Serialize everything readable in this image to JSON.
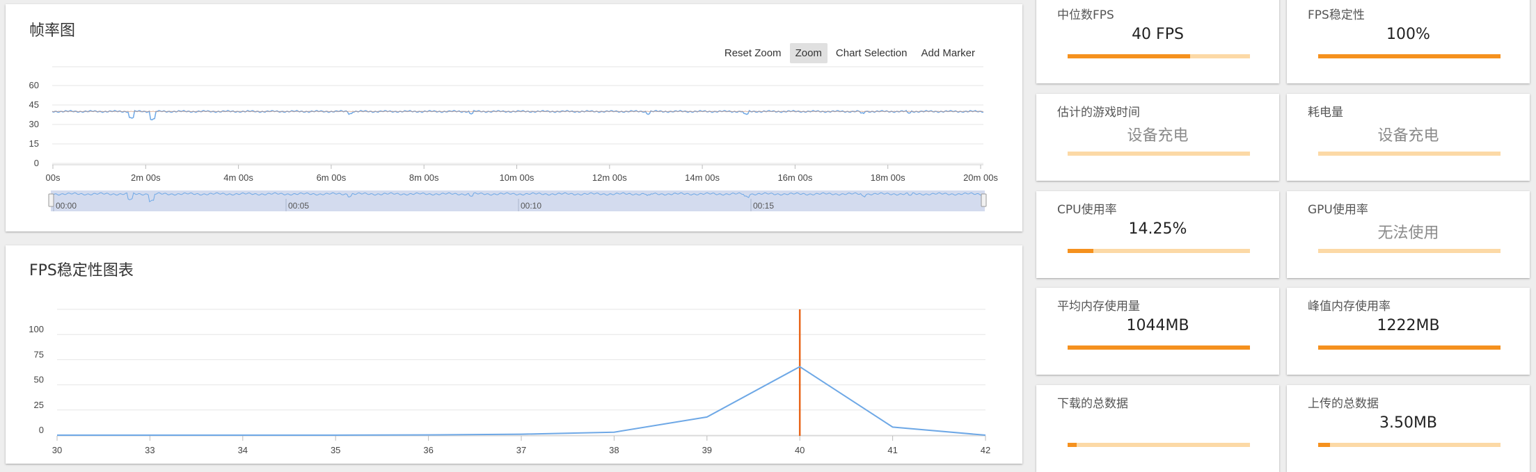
{
  "colors": {
    "accent": "#f5911e",
    "accent_light": "#fcd9a6",
    "line_blue": "#6ea8e6",
    "marker_orange": "#e8661a",
    "navigator_fill": "#d3dbee"
  },
  "frame_chart": {
    "title": "帧率图",
    "toolbar": [
      "Reset Zoom",
      "Zoom",
      "Chart Selection",
      "Add Marker"
    ],
    "active_tool": "Zoom",
    "y_ticks": [
      "60",
      "45",
      "30",
      "15",
      "0"
    ],
    "x_ticks": [
      "00s",
      "2m 00s",
      "4m 00s",
      "6m 00s",
      "8m 00s",
      "10m 00s",
      "12m 00s",
      "14m 00s",
      "16m 00s",
      "18m 00s",
      "20m 00s"
    ],
    "navigator_ticks": [
      "00:00",
      "00:05",
      "00:10",
      "00:15"
    ]
  },
  "stability_chart": {
    "title": "FPS稳定性图表",
    "y_ticks": [
      "100",
      "75",
      "50",
      "25",
      "0"
    ],
    "x_ticks": [
      "30",
      "33",
      "34",
      "35",
      "36",
      "37",
      "38",
      "39",
      "40",
      "41",
      "42"
    ]
  },
  "chart_data": [
    {
      "type": "line",
      "title": "帧率图",
      "xlabel": "",
      "ylabel": "",
      "ylim": [
        0,
        60
      ],
      "x_range_seconds": [
        0,
        1210
      ],
      "series": [
        {
          "values_approx": "flat around 40 FPS with occasional dips to ~36 and ~33",
          "mean": 40
        }
      ],
      "grid": true
    },
    {
      "type": "line",
      "title": "FPS稳定性图表",
      "xlabel": "",
      "ylabel": "",
      "ylim": [
        0,
        125
      ],
      "categories": [
        "30",
        "33",
        "34",
        "35",
        "36",
        "37",
        "38",
        "39",
        "40",
        "41",
        "42"
      ],
      "series": [
        {
          "values": [
            0,
            0,
            0,
            0,
            0.3,
            1,
            3,
            18,
            68,
            8,
            0
          ]
        }
      ],
      "marker_at": "40",
      "grid": true
    }
  ],
  "stats": [
    {
      "label": "中位数FPS",
      "value": "40 FPS",
      "progress": 0.67,
      "muted": false
    },
    {
      "label": "FPS稳定性",
      "value": "100%",
      "progress": 1.0,
      "muted": false
    },
    {
      "label": "估计的游戏时间",
      "value": "设备充电",
      "progress": 0,
      "muted": true
    },
    {
      "label": "耗电量",
      "value": "设备充电",
      "progress": 0,
      "muted": true
    },
    {
      "label": "CPU使用率",
      "value": "14.25%",
      "progress": 0.1425,
      "muted": false
    },
    {
      "label": "GPU使用率",
      "value": "无法使用",
      "progress": 0,
      "muted": true
    },
    {
      "label": "平均内存使用量",
      "value": "1044MB",
      "progress": 1.0,
      "muted": false
    },
    {
      "label": "峰值内存使用率",
      "value": "1222MB",
      "progress": 1.0,
      "muted": false
    },
    {
      "label": "下载的总数据",
      "value": "",
      "progress": 0.05,
      "muted": false
    },
    {
      "label": "上传的总数据",
      "value": "3.50MB",
      "progress": 0.065,
      "muted": false
    }
  ]
}
